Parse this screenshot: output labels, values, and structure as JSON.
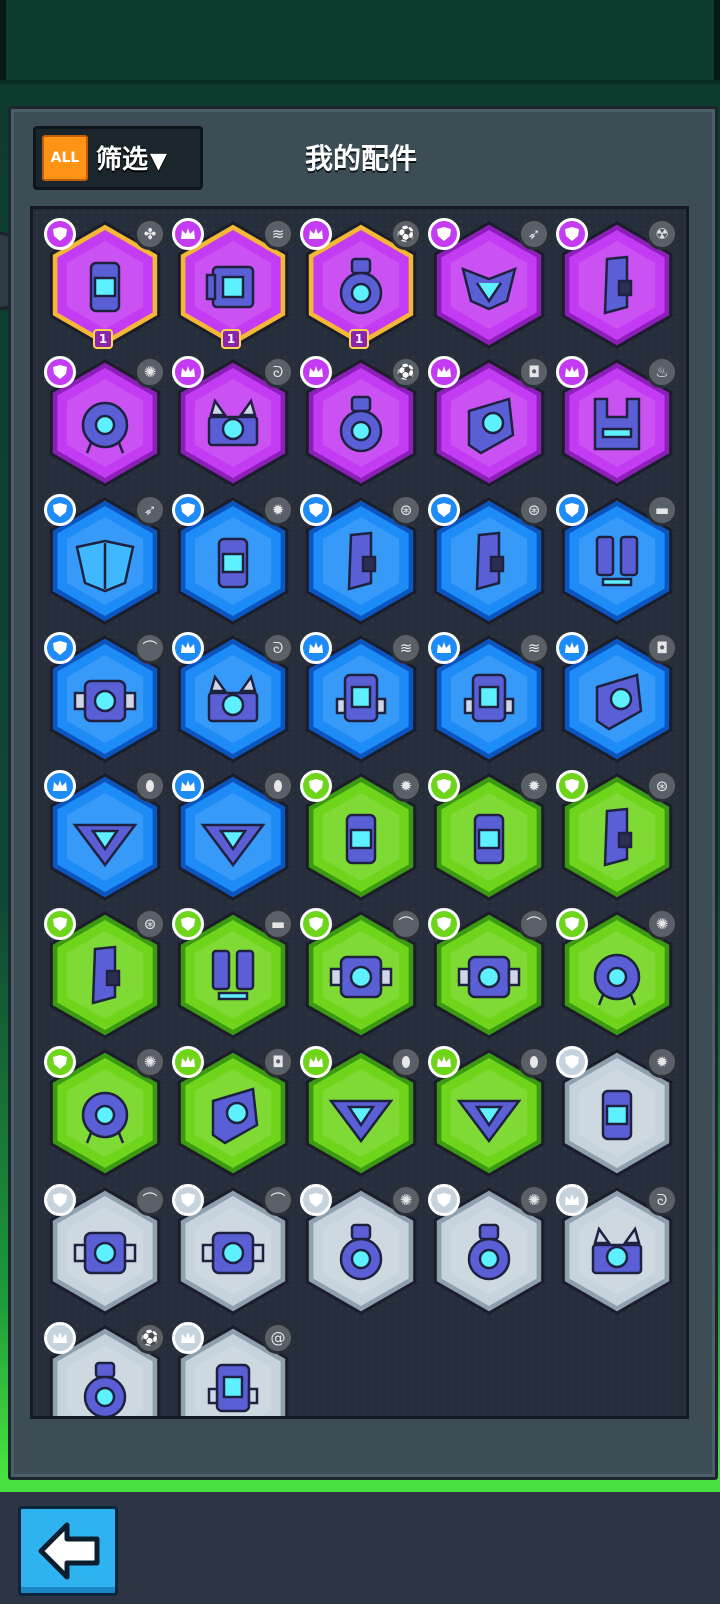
{
  "header": {
    "title": "我的配件",
    "filter_label": "筛选",
    "all_label": "ALL"
  },
  "colors": {
    "purple": "#c33bf2",
    "blue": "#1d8cf7",
    "green": "#6fd51b",
    "white": "#c7d3dc",
    "purple_dark": "#8b1fb8",
    "blue_dark": "#0b55c0",
    "green_dark": "#3c9a12",
    "white_dark": "#8fa0ac"
  },
  "parts": [
    {
      "rarity": "purple",
      "rank": "shield",
      "icon": "capsule-core",
      "res": "clover",
      "level": "1",
      "frame": "gold"
    },
    {
      "rarity": "purple",
      "rank": "crown",
      "icon": "engine-block",
      "res": "spring",
      "level": "1",
      "frame": "gold"
    },
    {
      "rarity": "purple",
      "rank": "crown",
      "icon": "eye-turret",
      "res": "ball",
      "level": "1",
      "frame": "gold"
    },
    {
      "rarity": "purple",
      "rank": "shield",
      "icon": "v-armor",
      "res": "rocket"
    },
    {
      "rarity": "purple",
      "rank": "shield",
      "icon": "arm-plate",
      "res": "radiation"
    },
    {
      "rarity": "purple",
      "rank": "shield",
      "icon": "drone-eye",
      "res": "sun"
    },
    {
      "rarity": "purple",
      "rank": "crown",
      "icon": "scanner",
      "res": "coil"
    },
    {
      "rarity": "purple",
      "rank": "crown",
      "icon": "eye-turret",
      "res": "ball"
    },
    {
      "rarity": "purple",
      "rank": "crown",
      "icon": "cannon-eye",
      "res": "camera"
    },
    {
      "rarity": "purple",
      "rank": "crown",
      "icon": "visor-helm",
      "res": "fire"
    },
    {
      "rarity": "blue",
      "rank": "shield",
      "icon": "wing-shield",
      "res": "rocket"
    },
    {
      "rarity": "blue",
      "rank": "shield",
      "icon": "capsule-core",
      "res": "gear"
    },
    {
      "rarity": "blue",
      "rank": "shield",
      "icon": "arm-plate",
      "res": "wheel"
    },
    {
      "rarity": "blue",
      "rank": "shield",
      "icon": "arm-plate",
      "res": "wheel"
    },
    {
      "rarity": "blue",
      "rank": "shield",
      "icon": "twin-legs",
      "res": "brick"
    },
    {
      "rarity": "blue",
      "rank": "shield",
      "icon": "box-eye",
      "res": "dome"
    },
    {
      "rarity": "blue",
      "rank": "crown",
      "icon": "scanner",
      "res": "coil"
    },
    {
      "rarity": "blue",
      "rank": "crown",
      "icon": "window-block",
      "res": "spring"
    },
    {
      "rarity": "blue",
      "rank": "crown",
      "icon": "window-block",
      "res": "spring"
    },
    {
      "rarity": "blue",
      "rank": "crown",
      "icon": "cannon-eye",
      "res": "camera"
    },
    {
      "rarity": "blue",
      "rank": "crown",
      "icon": "tri-gem",
      "res": "bullet"
    },
    {
      "rarity": "blue",
      "rank": "crown",
      "icon": "tri-gem",
      "res": "bullet"
    },
    {
      "rarity": "green",
      "rank": "shield",
      "icon": "capsule-core",
      "res": "gear"
    },
    {
      "rarity": "green",
      "rank": "shield",
      "icon": "capsule-core",
      "res": "gear"
    },
    {
      "rarity": "green",
      "rank": "shield",
      "icon": "arm-plate",
      "res": "wheel"
    },
    {
      "rarity": "green",
      "rank": "shield",
      "icon": "arm-plate",
      "res": "wheel"
    },
    {
      "rarity": "green",
      "rank": "shield",
      "icon": "twin-legs",
      "res": "brick"
    },
    {
      "rarity": "green",
      "rank": "shield",
      "icon": "box-eye",
      "res": "dome"
    },
    {
      "rarity": "green",
      "rank": "shield",
      "icon": "box-eye",
      "res": "dome"
    },
    {
      "rarity": "green",
      "rank": "shield",
      "icon": "drone-eye",
      "res": "sun"
    },
    {
      "rarity": "green",
      "rank": "shield",
      "icon": "drone-eye",
      "res": "sun"
    },
    {
      "rarity": "green",
      "rank": "crown",
      "icon": "cannon-eye",
      "res": "camera"
    },
    {
      "rarity": "green",
      "rank": "crown",
      "icon": "tri-gem",
      "res": "bullet"
    },
    {
      "rarity": "green",
      "rank": "crown",
      "icon": "tri-gem",
      "res": "bullet"
    },
    {
      "rarity": "white",
      "rank": "shield",
      "icon": "capsule-core",
      "res": "gear"
    },
    {
      "rarity": "white",
      "rank": "shield",
      "icon": "box-eye",
      "res": "dome"
    },
    {
      "rarity": "white",
      "rank": "shield",
      "icon": "box-eye",
      "res": "dome"
    },
    {
      "rarity": "white",
      "rank": "shield",
      "icon": "eye-turret",
      "res": "sun"
    },
    {
      "rarity": "white",
      "rank": "shield",
      "icon": "eye-turret",
      "res": "sun"
    },
    {
      "rarity": "white",
      "rank": "crown",
      "icon": "scanner",
      "res": "coil"
    },
    {
      "rarity": "white",
      "rank": "crown",
      "icon": "eye-turret",
      "res": "ball"
    },
    {
      "rarity": "white",
      "rank": "crown",
      "icon": "window-block",
      "res": "snail"
    }
  ],
  "footer": {
    "back_icon": "left-arrow-icon"
  }
}
